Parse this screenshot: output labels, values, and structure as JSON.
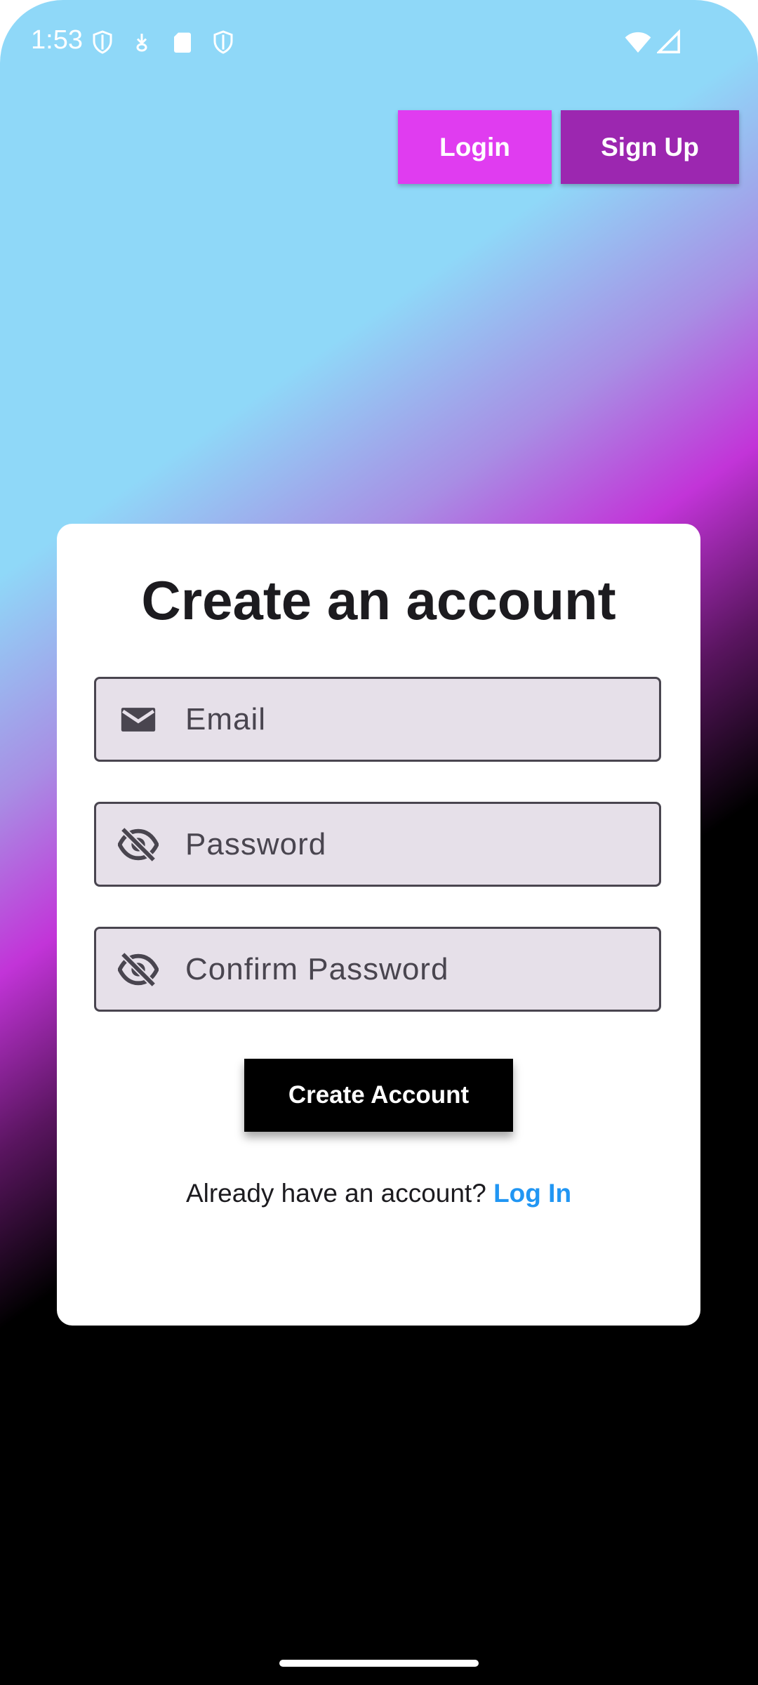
{
  "status_bar": {
    "time": "1:53",
    "icons": [
      "shield-icon",
      "download-icon",
      "sd-card-icon",
      "shield-icon",
      "wifi-icon",
      "signal-icon"
    ]
  },
  "nav": {
    "login_label": "Login",
    "signup_label": "Sign Up"
  },
  "form": {
    "title": "Create an account",
    "email": {
      "placeholder": "Email",
      "value": "",
      "icon": "mail-icon"
    },
    "password": {
      "placeholder": "Password",
      "value": "",
      "icon": "visibility-off-icon"
    },
    "confirm_password": {
      "placeholder": "Confirm Password",
      "value": "",
      "icon": "visibility-off-icon"
    },
    "submit_label": "Create Account",
    "footer_prompt": "Already have an account?",
    "footer_link": "Log In"
  },
  "colors": {
    "login_button": "#e03cf0",
    "signup_button": "#9c27b0",
    "field_background": "#e6e0e9",
    "link": "#2196f3",
    "gradient": [
      "#8fd8f8",
      "#c234d8",
      "#000000"
    ]
  }
}
